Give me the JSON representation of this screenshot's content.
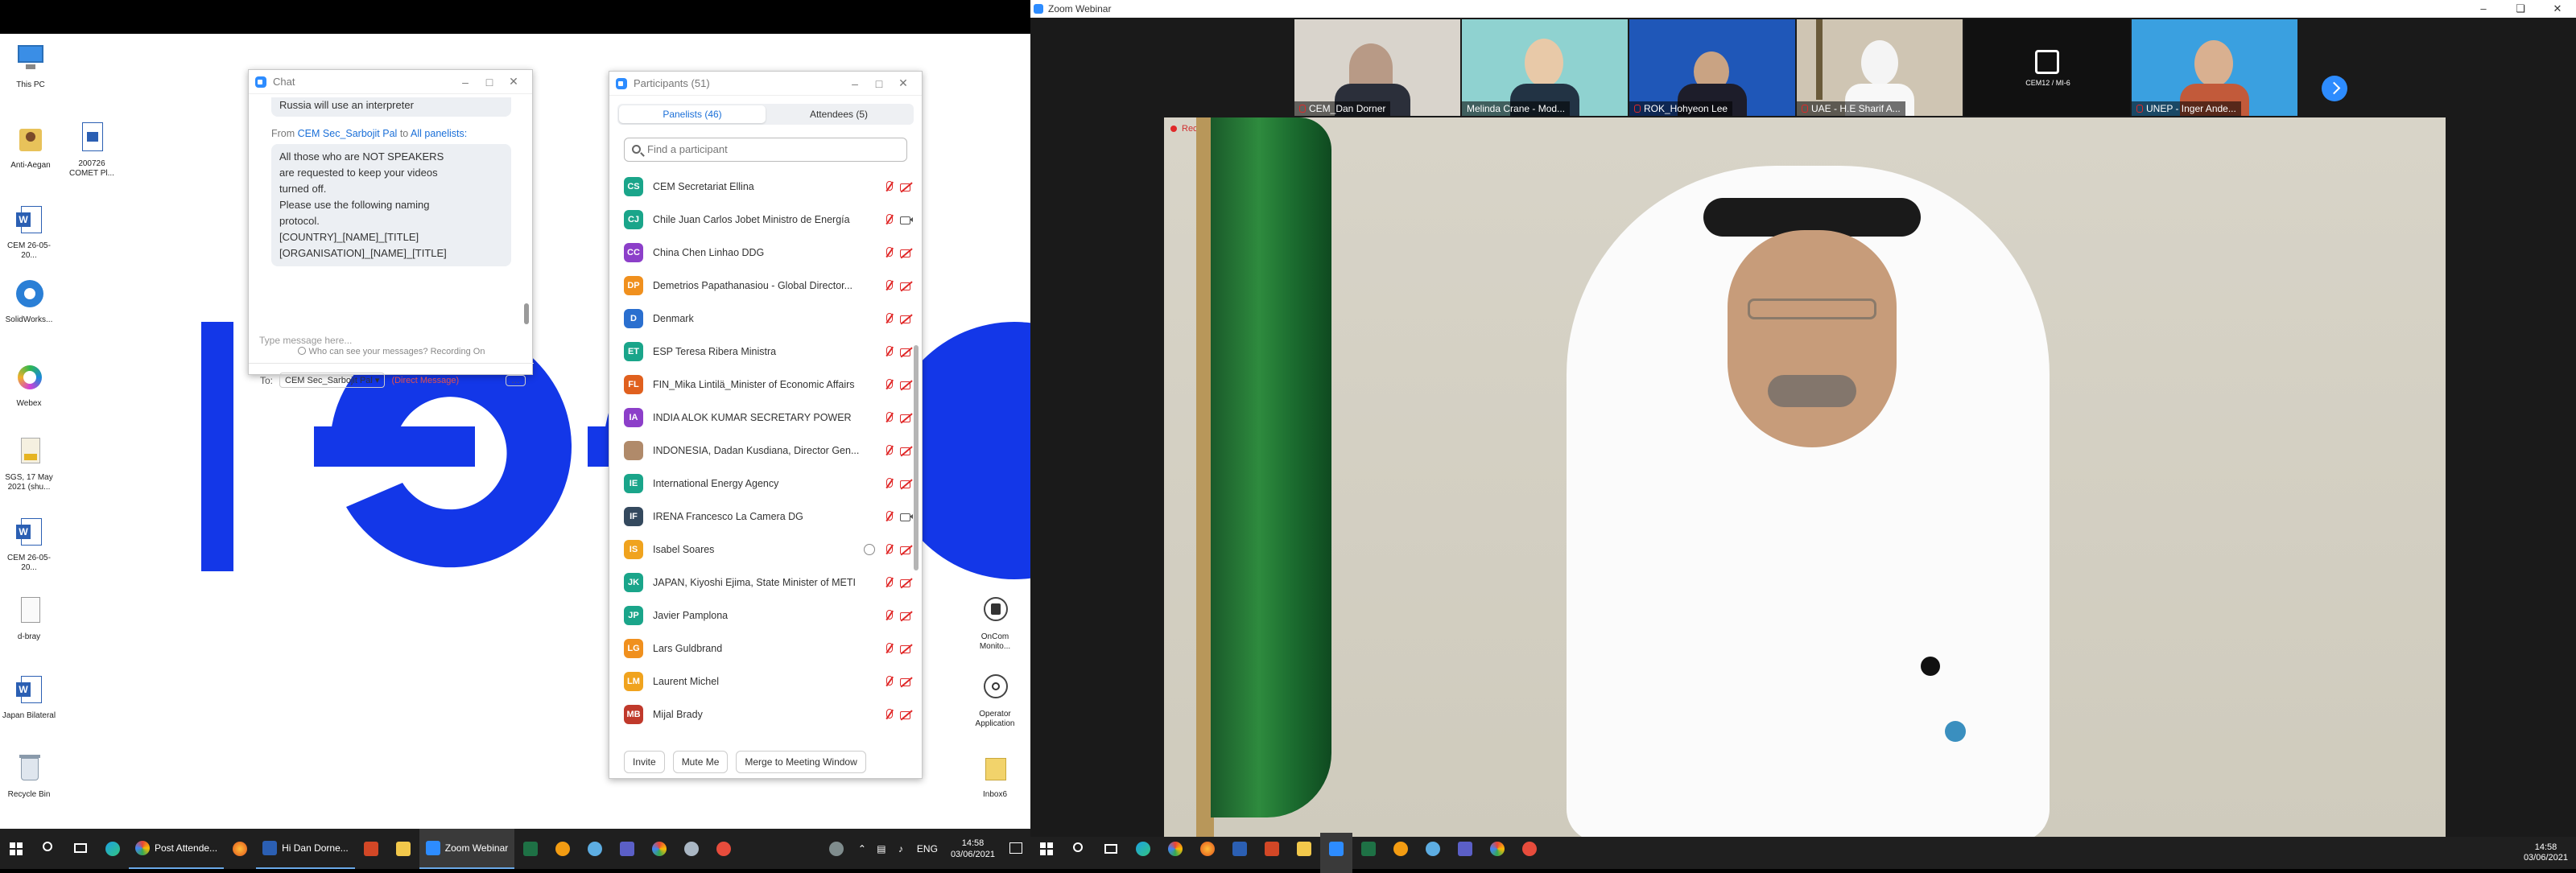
{
  "desktop": {
    "icons": [
      {
        "label": "This PC",
        "icon": "computer-icon"
      },
      {
        "label": "Anti-Aegan",
        "icon": "user-folder-icon"
      },
      {
        "label": "200726 COMET Pl...",
        "icon": "document-icon"
      },
      {
        "label": "CEM 26-05-20...",
        "icon": "word-icon"
      },
      {
        "label": "SolidWorks...",
        "icon": "solidworks-icon"
      },
      {
        "label": "Webex",
        "icon": "webex-icon"
      },
      {
        "label": "SGS, 17 May 2021 (shu...",
        "icon": "file-icon"
      },
      {
        "label": "CEM 26-05-20...",
        "icon": "word-icon"
      },
      {
        "label": "d-bray",
        "icon": "file-icon"
      },
      {
        "label": "Japan Bilateral",
        "icon": "word-icon"
      },
      {
        "label": "Recycle Bin",
        "icon": "recycle-bin-icon"
      },
      {
        "label": "OnCom Monito...",
        "icon": "app-icon"
      },
      {
        "label": "Operator Application",
        "icon": "podcast-icon"
      },
      {
        "label": "Inbox6",
        "icon": "folder-icon"
      }
    ]
  },
  "chat": {
    "title": "Chat",
    "top_message": "Russia will use an interpreter",
    "from_prefix": "From",
    "from_sender": "CEM Sec_Sarbojit Pal",
    "from_to": "to",
    "from_recipient": "All panelists:",
    "message_lines": [
      "All those who are NOT SPEAKERS",
      "are requested to keep your videos",
      "turned off.",
      "Please use the following naming",
      "protocol.",
      "[COUNTRY]_[NAME]_[TITLE]",
      "[ORGANISATION]_[NAME]_[TITLE]"
    ],
    "privacy_note": "Who can see your messages? Recording On",
    "to_label": "To:",
    "to_selected": "CEM Sec_Sarbojit Pal",
    "direct_message": "(Direct Message)",
    "input_placeholder": "Type message here..."
  },
  "participants": {
    "title": "Participants (51)",
    "tab_panelists": "Panelists (46)",
    "tab_attendees": "Attendees (5)",
    "search_placeholder": "Find a participant",
    "rows": [
      {
        "initials": "CS",
        "color": "#1aa58a",
        "name": "CEM Secretariat Ellina",
        "mic": "off",
        "cam": "off"
      },
      {
        "initials": "CJ",
        "color": "#1aa58a",
        "name": "Chile Juan Carlos Jobet Ministro de Energía",
        "mic": "off",
        "cam": "on"
      },
      {
        "initials": "CC",
        "color": "#8c3fc9",
        "name": "China Chen Linhao DDG",
        "mic": "off",
        "cam": "off"
      },
      {
        "initials": "DP",
        "color": "#f0901e",
        "name": "Demetrios Papathanasiou - Global Director...",
        "mic": "off",
        "cam": "off"
      },
      {
        "initials": "D",
        "color": "#2a6fcf",
        "name": "Denmark",
        "mic": "off",
        "cam": "off"
      },
      {
        "initials": "ET",
        "color": "#1aa58a",
        "name": "ESP Teresa Ribera Ministra",
        "mic": "off",
        "cam": "off"
      },
      {
        "initials": "FL",
        "color": "#e0601e",
        "name": "FIN_Mika Lintilä_Minister of Economic Affairs",
        "mic": "off",
        "cam": "off"
      },
      {
        "initials": "IA",
        "color": "#8c3fc9",
        "name": "INDIA ALOK KUMAR SECRETARY POWER",
        "mic": "off",
        "cam": "off"
      },
      {
        "initials": "",
        "color": "#b08a6a",
        "name": "INDONESIA, Dadan Kusdiana, Director Gen...",
        "mic": "off",
        "cam": "off"
      },
      {
        "initials": "IE",
        "color": "#1aa58a",
        "name": "International Energy Agency",
        "mic": "off",
        "cam": "off"
      },
      {
        "initials": "IF",
        "color": "#34495e",
        "name": "IRENA Francesco La Camera DG",
        "mic": "off",
        "cam": "on"
      },
      {
        "initials": "IS",
        "color": "#f0a31e",
        "name": "Isabel Soares",
        "mic": "off",
        "cam": "off",
        "hand": true
      },
      {
        "initials": "JK",
        "color": "#1aa58a",
        "name": "JAPAN, Kiyoshi Ejima, State Minister of METI",
        "mic": "off",
        "cam": "off"
      },
      {
        "initials": "JP",
        "color": "#1aa58a",
        "name": "Javier Pamplona",
        "mic": "off",
        "cam": "off"
      },
      {
        "initials": "LG",
        "color": "#f0901e",
        "name": "Lars Guldbrand",
        "mic": "off",
        "cam": "off"
      },
      {
        "initials": "LM",
        "color": "#f0a31e",
        "name": "Laurent Michel",
        "mic": "off",
        "cam": "off"
      },
      {
        "initials": "MB",
        "color": "#c0392b",
        "name": "Mijal Brady",
        "mic": "off",
        "cam": "off"
      }
    ],
    "btn_invite": "Invite",
    "btn_mute": "Mute Me",
    "btn_merge": "Merge to Meeting Window"
  },
  "left_taskbar": {
    "apps": [
      {
        "label": "Post Attende...",
        "icon": "chrome-icon"
      },
      {
        "label": "Hi Dan Dorne...",
        "icon": "word-icon"
      },
      {
        "label": "Zoom Webinar",
        "icon": "zoom-icon"
      }
    ],
    "language": "ENG",
    "time": "14:58",
    "date": "03/06/2021"
  },
  "zoom": {
    "window_title": "Zoom Webinar",
    "thumbnails": [
      {
        "name": "CEM_Dan Dorner",
        "bg": "#d9d4cc"
      },
      {
        "name": "Melinda Crane - Mod...",
        "bg": "#8fd2d0"
      },
      {
        "name": "ROK_Hohyeon Lee",
        "bg": "#1f57b8"
      },
      {
        "name": "UAE - H.E Sharif A...",
        "bg": "#cfc5b3"
      },
      {
        "name": "",
        "bg": "#111111",
        "logo": "CEM12 / MI-6"
      },
      {
        "name": "UNEP - Inger Ande...",
        "bg": "#3aa0e0"
      }
    ],
    "recording": "Recording...",
    "time": "14:58",
    "date": "03/06/2021"
  }
}
